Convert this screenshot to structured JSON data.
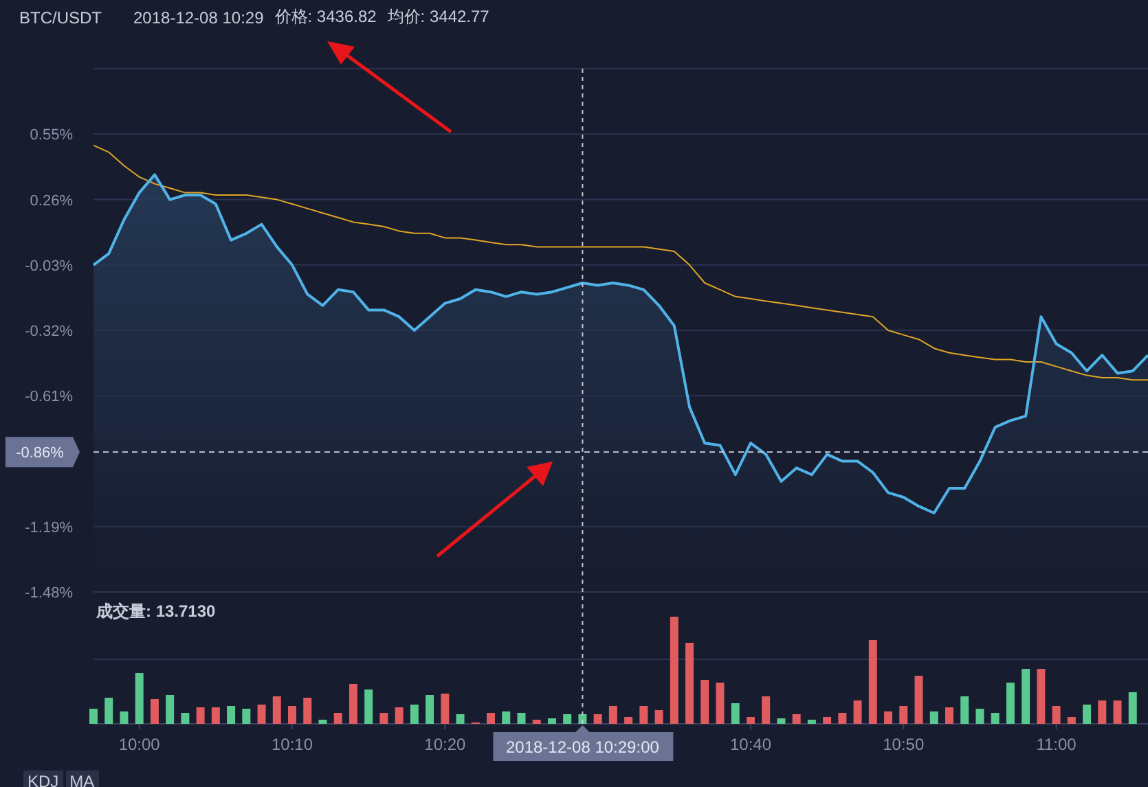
{
  "header": {
    "symbol": "BTC/USDT",
    "time": "2018-12-08 10:29",
    "price_label": "价格: 3436.82",
    "avg_label": "均价: 3442.77"
  },
  "price_chart": {
    "crosshair_time": "2018-12-08 10:29:00",
    "chart_data": {
      "type": "area",
      "grid": true,
      "series": [
        {
          "color": "#4fb3e8",
          "values": [
            -0.03,
            0.02,
            0.17,
            0.29,
            0.37,
            0.26,
            0.28,
            0.28,
            0.24,
            0.08,
            0.11,
            0.15,
            0.05,
            -0.03,
            -0.16,
            -0.21,
            -0.14,
            -0.15,
            -0.23,
            -0.23,
            -0.26,
            -0.32,
            -0.26,
            -0.2,
            -0.18,
            -0.14,
            -0.15,
            -0.17,
            -0.15,
            -0.16,
            -0.15,
            -0.13,
            -0.11,
            -0.12,
            -0.11,
            -0.12,
            -0.14,
            -0.21,
            -0.3,
            -0.66,
            -0.82,
            -0.83,
            -0.96,
            -0.82,
            -0.87,
            -0.99,
            -0.93,
            -0.96,
            -0.87,
            -0.9,
            -0.9,
            -0.95,
            -1.04,
            -1.06,
            -1.1,
            -1.13,
            -1.02,
            -1.02,
            -0.9,
            -0.75,
            -0.72,
            -0.7,
            -0.26,
            -0.38,
            -0.42,
            -0.5,
            -0.43,
            -0.51,
            -0.5,
            -0.43
          ]
        },
        {
          "type": "line",
          "color": "#e0a526",
          "values": [
            0.5,
            0.47,
            0.41,
            0.36,
            0.33,
            0.31,
            0.29,
            0.29,
            0.28,
            0.28,
            0.28,
            0.27,
            0.26,
            0.24,
            0.22,
            0.2,
            0.18,
            0.16,
            0.15,
            0.14,
            0.12,
            0.11,
            0.11,
            0.09,
            0.09,
            0.08,
            0.07,
            0.06,
            0.06,
            0.05,
            0.05,
            0.05,
            0.05,
            0.05,
            0.05,
            0.05,
            0.05,
            0.04,
            0.03,
            -0.03,
            -0.11,
            -0.14,
            -0.17,
            -0.18,
            -0.19,
            -0.2,
            -0.21,
            -0.22,
            -0.23,
            -0.24,
            -0.25,
            -0.26,
            -0.32,
            -0.34,
            -0.36,
            -0.4,
            -0.42,
            -0.43,
            -0.44,
            -0.45,
            -0.45,
            -0.46,
            -0.46,
            -0.48,
            -0.5,
            -0.52,
            -0.53,
            -0.53,
            -0.54,
            -0.54
          ]
        }
      ],
      "ylim": [
        -1.48,
        0.84
      ],
      "yticks": [
        {
          "value": 0.55,
          "label": "0.55%"
        },
        {
          "value": 0.26,
          "label": "0.26%"
        },
        {
          "value": -0.03,
          "label": "-0.03%"
        },
        {
          "value": -0.32,
          "label": "-0.32%"
        },
        {
          "value": -0.61,
          "label": "-0.61%"
        },
        {
          "value": -1.19,
          "label": "-1.19%"
        },
        {
          "value": -1.48,
          "label": "-1.48%"
        }
      ],
      "ref_lines": [
        {
          "axis": "y",
          "value": -0.86,
          "label": "-0.86%"
        }
      ]
    }
  },
  "volume": {
    "label": "成交量: 13.7130",
    "time_labels": [
      "10:00",
      "10:10",
      "10:20",
      "10:40",
      "10:50",
      "11:00"
    ]
  },
  "indicator_tabs": [
    {
      "label": "KDJ"
    },
    {
      "label": "MA"
    }
  ]
}
